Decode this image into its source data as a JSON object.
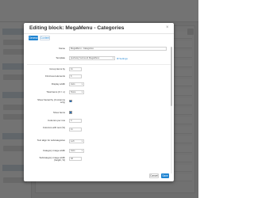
{
  "modal": {
    "title": "Editing block: MegaMenu - Categories",
    "close_glyph": "×",
    "save_label": "Save",
    "cancel_label": "Cancel",
    "save_bottom_label": "Save"
  },
  "tabs": [
    {
      "label": "General",
      "active": true
    },
    {
      "label": "Content",
      "active": false
    }
  ],
  "form": {
    "name": {
      "label": "Name",
      "value": "MegaMenu - Categories"
    },
    "template": {
      "label": "Template",
      "value": "[surface] Surround MegaMenu",
      "link": "Settings"
    },
    "grouping": {
      "label": "Group items by",
      "value": "11"
    },
    "first_level": {
      "label": "First level elements",
      "value": "6"
    },
    "display_width": {
      "label": "Display width",
      "value": "Auto"
    },
    "total_items": {
      "label": "Total items (0 = ∞)",
      "value": "None"
    },
    "show_child": {
      "label": "Show hierarchy (0 columns only)",
      "checked": true
    },
    "show_items": {
      "label": "Show items",
      "checked": true
    },
    "columns": {
      "label": "Columns per row",
      "value": "4"
    },
    "columns_with": {
      "label": "Columns with text (%)",
      "value": "11"
    },
    "text_align": {
      "label": "Text align for subcategories",
      "value": "Left"
    },
    "image_width": {
      "label": "Category image width",
      "value": "Auto"
    },
    "image_height": {
      "label": "Subcategory image width (height, %)",
      "value": "40"
    }
  },
  "colors": {
    "primary": "#1f84d2",
    "overlay": "rgba(0,0,0,0.55)"
  }
}
